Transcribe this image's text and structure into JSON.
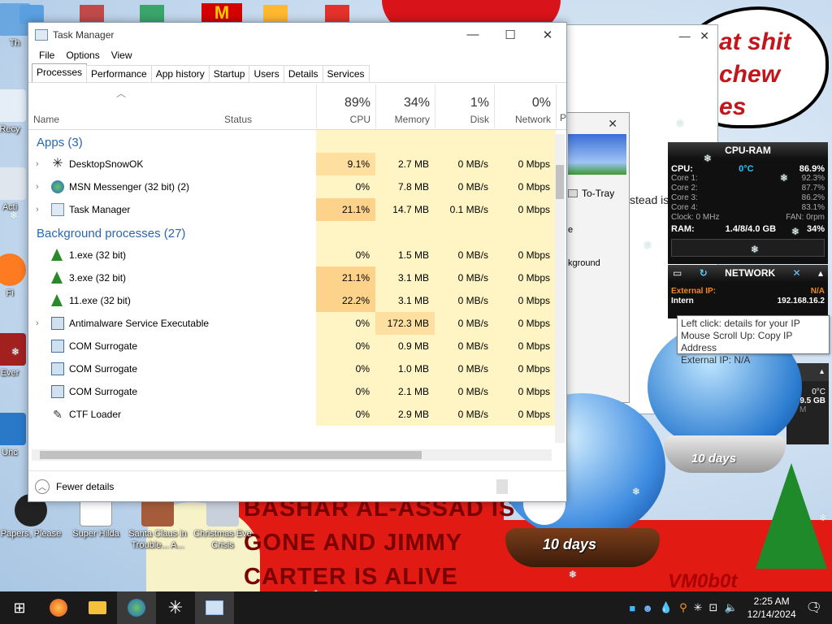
{
  "desktop": {
    "icons": [
      {
        "label": "Th"
      },
      {
        "label": "Recy"
      },
      {
        "label": "Acti"
      },
      {
        "label": "Fi"
      },
      {
        "label": "Ever"
      },
      {
        "label": "Unc"
      },
      {
        "label": "Papers, Please"
      },
      {
        "label": "Super Hilda"
      },
      {
        "label": "Santa Claus in Trouble... A..."
      },
      {
        "label": "Christmas Eve Crisis"
      }
    ],
    "speech_text_1": "at shit",
    "speech_text_2": "chew",
    "speech_text_3": "es",
    "banner_lines": [
      "BASHAR AL-ASSAD IS",
      "GONE AND JIMMY",
      "CARTER IS ALIVE"
    ],
    "signature": "VM0b0t",
    "globe_label": "10 days",
    "globe_label_2": "10 days"
  },
  "back_window": {
    "to_tray": "To-Tray",
    "instead_text": "stead is",
    "e_text": "e",
    "background_text": "kground"
  },
  "task_manager": {
    "title": "Task Manager",
    "menu": [
      "File",
      "Options",
      "View"
    ],
    "tabs": [
      "Processes",
      "Performance",
      "App history",
      "Startup",
      "Users",
      "Details",
      "Services"
    ],
    "header": {
      "name": "Name",
      "status": "Status",
      "cpu": {
        "pct": "89%",
        "label": "CPU"
      },
      "memory": {
        "pct": "34%",
        "label": "Memory"
      },
      "disk": {
        "pct": "1%",
        "label": "Disk"
      },
      "network": {
        "pct": "0%",
        "label": "Network"
      },
      "extra": "P"
    },
    "apps_group": "Apps (3)",
    "apps": [
      {
        "name": "DesktopSnowOK",
        "cpu": "9.1%",
        "mem": "2.7 MB",
        "disk": "0 MB/s",
        "net": "0 Mbps",
        "icon": "snowflake-icon",
        "expand": true
      },
      {
        "name": "MSN Messenger (32 bit) (2)",
        "cpu": "0%",
        "mem": "7.8 MB",
        "disk": "0 MB/s",
        "net": "0 Mbps",
        "icon": "msn-icon",
        "expand": true
      },
      {
        "name": "Task Manager",
        "cpu": "21.1%",
        "mem": "14.7 MB",
        "disk": "0.1 MB/s",
        "net": "0 Mbps",
        "icon": "taskmanager-icon",
        "expand": true
      }
    ],
    "bg_group": "Background processes (27)",
    "background": [
      {
        "name": "1.exe (32 bit)",
        "cpu": "0%",
        "mem": "1.5 MB",
        "disk": "0 MB/s",
        "net": "0 Mbps",
        "icon": "tree-icon",
        "expand": false
      },
      {
        "name": "3.exe (32 bit)",
        "cpu": "21.1%",
        "mem": "3.1 MB",
        "disk": "0 MB/s",
        "net": "0 Mbps",
        "icon": "tree-icon",
        "expand": false
      },
      {
        "name": "11.exe (32 bit)",
        "cpu": "22.2%",
        "mem": "3.1 MB",
        "disk": "0 MB/s",
        "net": "0 Mbps",
        "icon": "tree-icon",
        "expand": false
      },
      {
        "name": "Antimalware Service Executable",
        "cpu": "0%",
        "mem": "172.3 MB",
        "disk": "0 MB/s",
        "net": "0 Mbps",
        "icon": "window-icon",
        "expand": true
      },
      {
        "name": "COM Surrogate",
        "cpu": "0%",
        "mem": "0.9 MB",
        "disk": "0 MB/s",
        "net": "0 Mbps",
        "icon": "window-icon",
        "expand": false
      },
      {
        "name": "COM Surrogate",
        "cpu": "0%",
        "mem": "1.0 MB",
        "disk": "0 MB/s",
        "net": "0 Mbps",
        "icon": "window-icon",
        "expand": false
      },
      {
        "name": "COM Surrogate",
        "cpu": "0%",
        "mem": "2.1 MB",
        "disk": "0 MB/s",
        "net": "0 Mbps",
        "icon": "window-icon",
        "expand": false
      },
      {
        "name": "CTF Loader",
        "cpu": "0%",
        "mem": "2.9 MB",
        "disk": "0 MB/s",
        "net": "0 Mbps",
        "icon": "pen-icon",
        "expand": false
      }
    ],
    "fewer_details": "Fewer details"
  },
  "cpu_widget": {
    "title": "CPU-RAM",
    "cpu_label": "CPU:",
    "temp": "0°C",
    "cpu_total": "86.9%",
    "cores": [
      {
        "label": "Core 1:",
        "value": "92.3%"
      },
      {
        "label": "Core 2:",
        "value": "87.7%"
      },
      {
        "label": "Core 3:",
        "value": "86.2%"
      },
      {
        "label": "Core 4:",
        "value": "83.1%"
      }
    ],
    "clock": "Clock: 0 MHz",
    "fan": "FAN: 0rpm",
    "ram_label": "RAM:",
    "ram_value": "1.4/",
    "ram_value_2": "8/4.0 GB",
    "ram_pct": "34%"
  },
  "network_widget": {
    "title": "NETWORK",
    "external_label": "External IP:",
    "external_value": "N/A",
    "internal_label": "Intern",
    "internal_value": "192.168.16.2"
  },
  "tooltip": {
    "line1": "Left click: details for your IP",
    "line2": "Mouse Scroll Up: Copy IP Address",
    "line3": "External IP: N/A"
  },
  "small_widget": {
    "temp": "0°C",
    "size": "9.5 GB",
    "unit": "M"
  },
  "taskbar": {
    "time": "2:25 AM",
    "date": "12/14/2024",
    "notification_count": "1"
  },
  "colors": {
    "cpu_heat_high": "#fdd28a",
    "cpu_heat_mid": "#ffe9a8",
    "cpu_heat_low": "#fff4c4",
    "group_blue": "#2a66b0",
    "banner_red": "#e11b14"
  }
}
